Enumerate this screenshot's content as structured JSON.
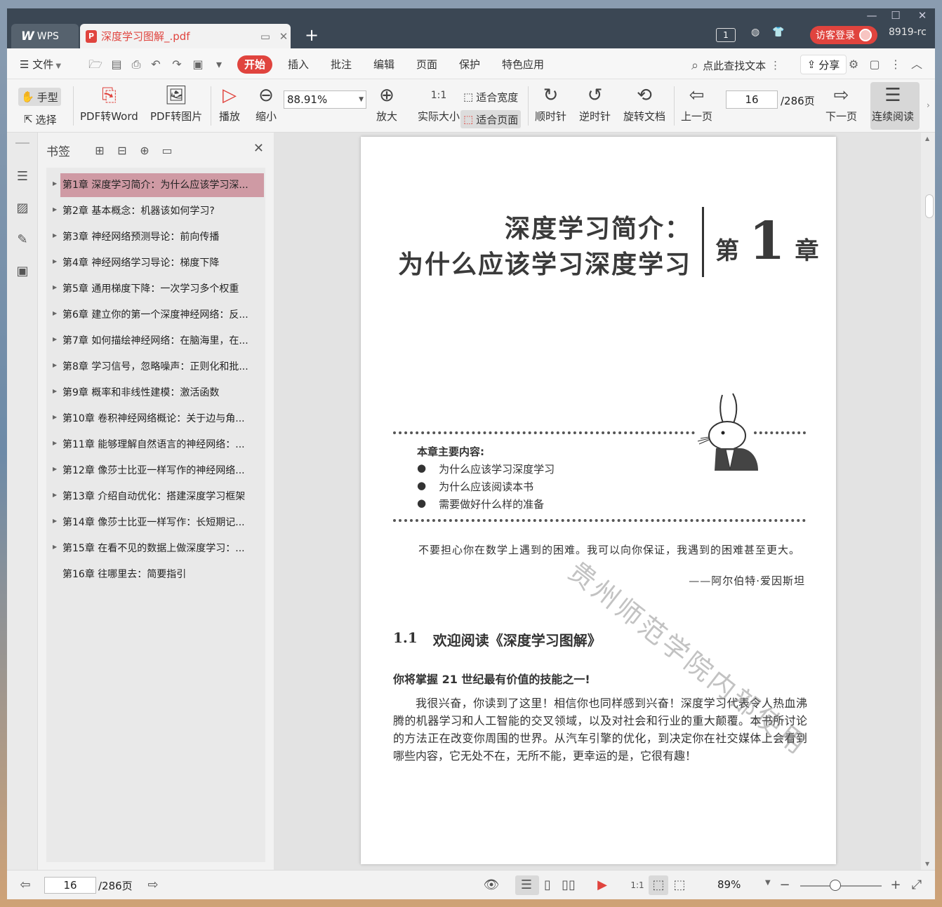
{
  "titlebar": {
    "app_label": "WPS",
    "doc_tab_title": "深度学习图解_.pdf",
    "count_badge": "1",
    "login_label": "访客登录",
    "user_id": "8919-rc"
  },
  "menu": {
    "file": "文件",
    "tabs": [
      "开始",
      "插入",
      "批注",
      "编辑",
      "页面",
      "保护",
      "特色应用"
    ],
    "active_tab": "开始",
    "search_placeholder": "点此查找文本",
    "share": "分享"
  },
  "ribbon": {
    "hand": "手型",
    "select": "选择",
    "pdf_to_word": "PDF转Word",
    "pdf_to_image": "PDF转图片",
    "play": "播放",
    "zoom_out": "缩小",
    "zoom_value": "88.91%",
    "zoom_in": "放大",
    "actual_size": "实际大小",
    "fit_width": "适合宽度",
    "fit_page": "适合页面",
    "clockwise": "顺时针",
    "counter_clockwise": "逆时针",
    "rotate_doc": "旋转文档",
    "prev_page": "上一页",
    "current_page": "16",
    "total_pages": "/286页",
    "next_page": "下一页",
    "continuous_read": "连续阅读"
  },
  "bookmarks": {
    "title": "书签",
    "items": [
      "第1章 深度学习简介：为什么应该学习深...",
      "第2章 基本概念：机器该如何学习?",
      "第3章 神经网络预测导论：前向传播",
      "第4章 神经网络学习导论：梯度下降",
      "第5章 通用梯度下降：一次学习多个权重",
      "第6章 建立你的第一个深度神经网络：反...",
      "第7章 如何描绘神经网络：在脑海里，在...",
      "第8章 学习信号，忽略噪声：正则化和批...",
      "第9章 概率和非线性建模：激活函数",
      "第10章 卷积神经网络概论：关于边与角...",
      "第11章 能够理解自然语言的神经网络：...",
      "第12章 像莎士比亚一样写作的神经网络...",
      "第13章 介绍自动优化：搭建深度学习框架",
      "第14章 像莎士比亚一样写作：长短期记...",
      "第15章 在看不见的数据上做深度学习：...",
      "第16章 往哪里去：简要指引"
    ]
  },
  "page": {
    "chapter_title_line1": "深度学习简介：",
    "chapter_title_line2": "为什么应该学习深度学习",
    "chapter_prefix": "第",
    "chapter_number": "1",
    "chapter_suffix": "章",
    "summary_heading": "本章主要内容:",
    "summary_items": [
      "为什么应该学习深度学习",
      "为什么应该阅读本书",
      "需要做好什么样的准备"
    ],
    "quote": "不要担心你在数学上遇到的困难。我可以向你保证，我遇到的困难甚至更大。",
    "quote_author": "——阿尔伯特·爱因斯坦",
    "section_number": "1.1",
    "section_title": "欢迎阅读《深度学习图解》",
    "subsection_title": "你将掌握 21 世纪最有价值的技能之一!",
    "body": "我很兴奋，你读到了这里！相信你也同样感到兴奋！深度学习代表令人热血沸腾的机器学习和人工智能的交叉领域，以及对社会和行业的重大颠覆。本书所讨论的方法正在改变你周围的世界。从汽车引擎的优化，到决定你在社交媒体上会看到哪些内容，它无处不在，无所不能，更幸运的是，它很有趣！",
    "watermark": "贵州师范学院内部使用"
  },
  "statusbar": {
    "current_page": "16",
    "total_pages": "/286页",
    "zoom": "89%"
  },
  "colors": {
    "accent": "#e0443e",
    "titlebar": "#3b4754",
    "selected_bookmark": "#cf9aa4"
  }
}
